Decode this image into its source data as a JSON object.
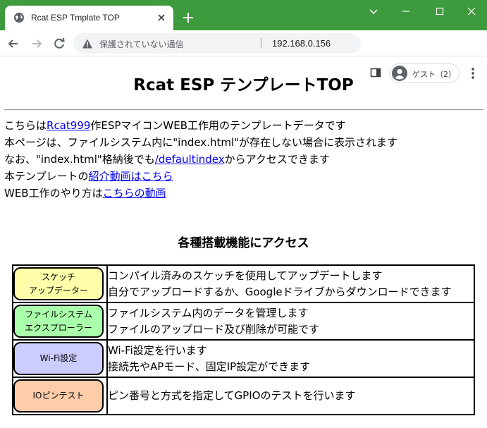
{
  "browser": {
    "tab_title": "Rcat ESP Tmplate TOP",
    "insecure_label": "保護されていない通信",
    "url": "192.168.0.156",
    "profile_label": "ゲスト（2）"
  },
  "page": {
    "title": "Rcat ESP テンプレートTOP",
    "intro": {
      "line1_prefix": "こちらは",
      "line1_link": "Rcat999",
      "line1_suffix": "作ESPマイコンWEB工作用のテンプレートデータです",
      "line2": "本ページは、ファイルシステム内に\"index.html\"が存在しない場合に表示されます",
      "line3_prefix": "なお、\"index.html\"格納後でも",
      "line3_link": "/defaultindex",
      "line3_suffix": "からアクセスできます",
      "line4_prefix": "本テンプレートの",
      "line4_link": "紹介動画はこちら",
      "line5_prefix": "WEB工作のやり方は",
      "line5_link": "こちらの動画"
    },
    "section_title": "各種搭載機能にアクセス",
    "features": [
      {
        "button_line1": "スケッチ",
        "button_line2": "アップデーター",
        "color": "#ffffaa",
        "desc1": "コンパイル済みのスケッチを使用してアップデートします",
        "desc2": "自分でアップロードするか、Googleドライブからダウンロードできます"
      },
      {
        "button_line1": "ファイルシステム",
        "button_line2": "エクスプローラー",
        "color": "#aaffaa",
        "desc1": "ファイルシステム内のデータを管理します",
        "desc2": "ファイルのアップロード及び削除が可能です"
      },
      {
        "button_line1": "Wi-Fi設定",
        "button_line2": "",
        "color": "#ccccff",
        "desc1": "Wi-Fi設定を行います",
        "desc2": "接続先やAPモード、固定IP設定ができます"
      },
      {
        "button_line1": "IOピンテスト",
        "button_line2": "",
        "color": "#ffccaa",
        "desc1": "ピン番号と方式を指定してGPIOのテストを行います",
        "desc2": ""
      }
    ]
  },
  "colors": {
    "titlebar": "#3d9b3d",
    "link": "#0000ee"
  }
}
